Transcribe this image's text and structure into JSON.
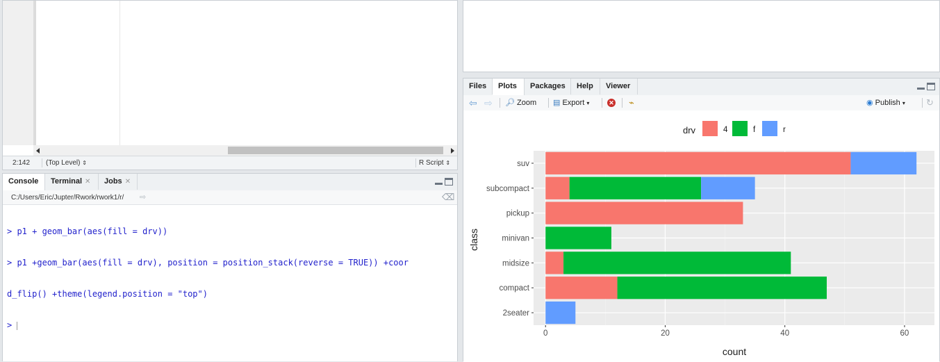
{
  "editor": {
    "cursor_position": "2:142",
    "scope": "(Top Level)",
    "file_type": "R Script"
  },
  "console": {
    "tabs": [
      "Console",
      "Terminal",
      "Jobs"
    ],
    "path": "C:/Users/Eric/Jupter/Rwork/rwork1/r/",
    "lines": [
      "> p1 + geom_bar(aes(fill = drv))",
      "> p1 +geom_bar(aes(fill = drv), position = position_stack(reverse = TRUE)) +coor",
      "d_flip() +theme(legend.position = \"top\")"
    ],
    "prompt": ">"
  },
  "files_pane": {
    "tabs": [
      "Files",
      "Plots",
      "Packages",
      "Help",
      "Viewer"
    ],
    "active_tab": "Plots",
    "toolbar": {
      "zoom": "Zoom",
      "export": "Export",
      "publish": "Publish"
    }
  },
  "chart_data": {
    "type": "bar",
    "orientation": "horizontal-stacked",
    "categories": [
      "suv",
      "subcompact",
      "pickup",
      "minivan",
      "midsize",
      "compact",
      "2seater"
    ],
    "series": [
      {
        "name": "4",
        "color": "#f8766d",
        "values": [
          51,
          4,
          33,
          0,
          3,
          12,
          0
        ]
      },
      {
        "name": "f",
        "color": "#00ba38",
        "values": [
          0,
          22,
          0,
          11,
          38,
          35,
          0
        ]
      },
      {
        "name": "r",
        "color": "#619cff",
        "values": [
          11,
          9,
          0,
          0,
          0,
          0,
          5
        ]
      }
    ],
    "legend_title": "drv",
    "legend_position": "top",
    "xlabel": "count",
    "ylabel": "class",
    "xlim": [
      -2,
      65
    ],
    "xticks": [
      "0",
      "20",
      "40",
      "60"
    ],
    "grid": true,
    "panel_background": "#ebebeb"
  }
}
